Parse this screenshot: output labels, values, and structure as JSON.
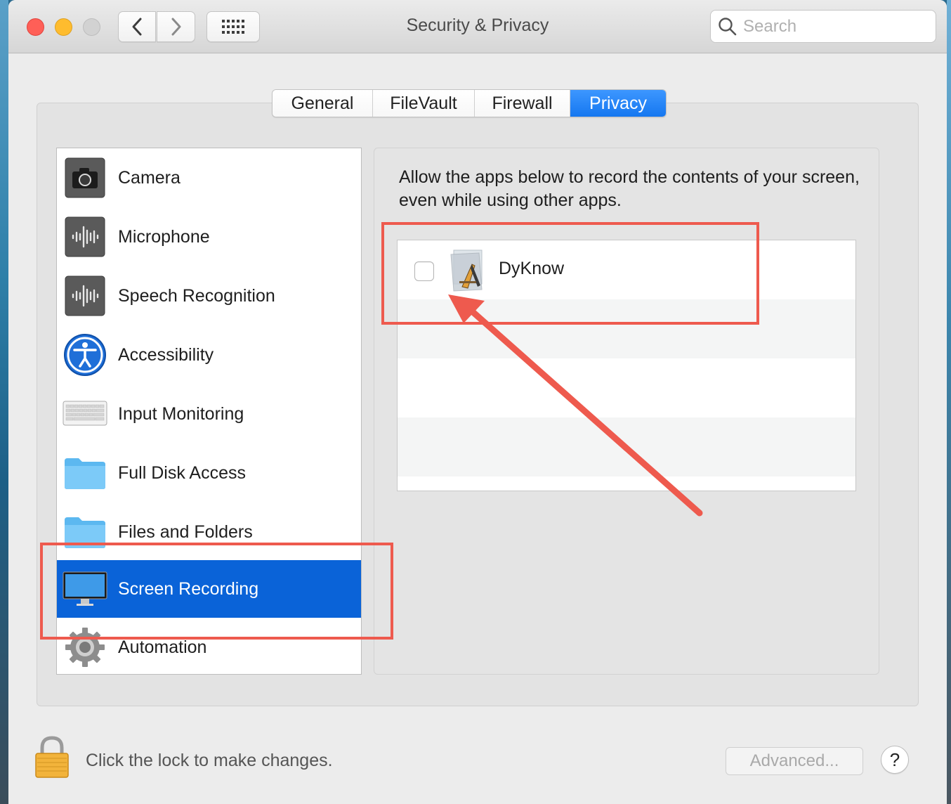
{
  "window": {
    "title": "Security & Privacy"
  },
  "toolbar": {
    "back_icon": "chevron-left-icon",
    "forward_icon": "chevron-right-icon",
    "show_all_icon": "grid-icon"
  },
  "search": {
    "placeholder": "Search",
    "value": ""
  },
  "tabs": [
    {
      "label": "General",
      "active": false
    },
    {
      "label": "FileVault",
      "active": false
    },
    {
      "label": "Firewall",
      "active": false
    },
    {
      "label": "Privacy",
      "active": true
    }
  ],
  "sidebar": {
    "items": [
      {
        "label": "Camera",
        "icon": "camera-icon",
        "selected": false
      },
      {
        "label": "Microphone",
        "icon": "microphone-icon",
        "selected": false
      },
      {
        "label": "Speech Recognition",
        "icon": "speech-recognition-icon",
        "selected": false
      },
      {
        "label": "Accessibility",
        "icon": "accessibility-icon",
        "selected": false
      },
      {
        "label": "Input Monitoring",
        "icon": "keyboard-icon",
        "selected": false
      },
      {
        "label": "Full Disk Access",
        "icon": "folder-icon",
        "selected": false
      },
      {
        "label": "Files and Folders",
        "icon": "folder-icon",
        "selected": false
      },
      {
        "label": "Screen Recording",
        "icon": "display-icon",
        "selected": true
      },
      {
        "label": "Automation",
        "icon": "gear-icon",
        "selected": false
      }
    ]
  },
  "detail": {
    "description": "Allow the apps below to record the contents of your screen, even while using other apps.",
    "apps": [
      {
        "name": "DyKnow",
        "checked": false,
        "icon": "application-icon"
      }
    ]
  },
  "footer": {
    "lock_text": "Click the lock to make changes.",
    "advanced_label": "Advanced...",
    "help_label": "?"
  },
  "colors": {
    "accent": "#1577f0",
    "selection": "#0a63d8",
    "annotation": "#ee5a4e"
  }
}
